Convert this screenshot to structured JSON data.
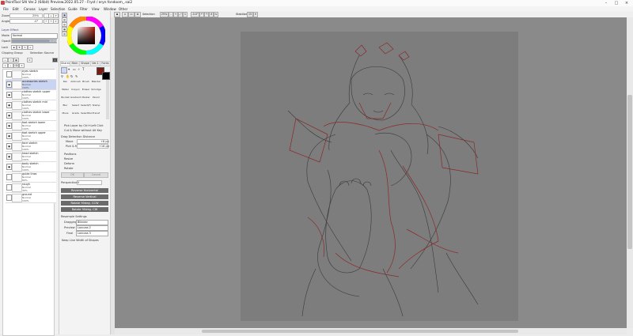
{
  "window": {
    "title": "PaintTool SAI Ver.2 (64bit) Preview.2022.05.27 - Fryst / eryn fondoom_.sai2"
  },
  "menu": [
    "File",
    "Edit",
    "Canvas",
    "Layer",
    "Selection",
    "Guide",
    "Filter",
    "View",
    "Window",
    "Other"
  ],
  "left": {
    "zoom_label": "Zoom",
    "zoom_value": "25%",
    "angle_label": "Angle",
    "angle_value": "-0°",
    "layer_effect": "Layer Effect",
    "mode_label": "Mode",
    "mode_value": "Normal",
    "opacity_label": "Opacity",
    "opacity_value": "100%",
    "lock_label": "Lock",
    "clipping": "Clipping Group",
    "sel_source": "Selection Source",
    "layers": [
      {
        "name": "eyes sketch",
        "mode": "Normal",
        "op": "100%"
      },
      {
        "name": "accessories sketch",
        "mode": "Normal",
        "op": "100%"
      },
      {
        "name": "clothes sketch upper",
        "mode": "Normal",
        "op": "100%"
      },
      {
        "name": "clothes sketch mid",
        "mode": "Normal",
        "op": "100%"
      },
      {
        "name": "clothes sketch lower",
        "mode": "Normal",
        "op": "100%"
      },
      {
        "name": "foot sketch lower",
        "mode": "Normal",
        "op": "100%"
      },
      {
        "name": "foot sketch upper",
        "mode": "Normal",
        "op": "100%"
      },
      {
        "name": "face sketch",
        "mode": "Normal",
        "op": "100%"
      },
      {
        "name": "head sketch",
        "mode": "Normal",
        "op": "100%"
      },
      {
        "name": "body sketch",
        "mode": "Normal",
        "op": "100%"
      },
      {
        "name": "guide lines",
        "mode": "Normal",
        "op": "60%"
      },
      {
        "name": "rough",
        "mode": "Normal",
        "op": "30%"
      },
      {
        "name": "ground",
        "mode": "Normal",
        "op": "100%"
      }
    ]
  },
  "tools": {
    "tabs": [
      "Shared",
      "Main",
      "Shape",
      "Ver.1",
      "Fonts"
    ],
    "grid": [
      "Pen",
      "Airbrush",
      "Brush",
      "Blender",
      "Water",
      "Crayon",
      "Eraser",
      "Smudge",
      "Bucket",
      "Gradient",
      "Marker",
      "Pencil",
      "Blur",
      "Select",
      "Select(F)",
      "Stamp",
      "Move",
      "Grade",
      "SelectPen",
      "Transf"
    ],
    "pick_layer": "Pick Layer by Ctrl+Left Click",
    "cut_move": "Cut & Move without Alt Key",
    "drag_dist": "Drag Detection Distance",
    "move_label": "Move",
    "move_value": "+8 px",
    "pick_label": "Pick & Move",
    "pick_value": "+16 px",
    "checks": [
      "Positions",
      "Resize",
      "Deform",
      "Rotate"
    ],
    "ok": "OK",
    "cancel": "Cancel",
    "perspective_label": "Perspective",
    "perspective_value": "0",
    "btns": [
      "Reverse Horizontal",
      "Reverse Vertical",
      "Rotate 90deg. CCW",
      "Rotate 90deg. CW"
    ],
    "resample_title": "Resample Settings",
    "dragging_label": "Dragging",
    "dragging_value": "Bilinear",
    "preview_label": "Preview",
    "preview_value": "Lanczos 2",
    "final_label": "Final",
    "final_value": "Lanczos 3",
    "keep_line": "Keep Line Width of Shapes"
  },
  "canvasbar": {
    "selection_label": "Selection",
    "zoom_value": "25%",
    "angle_value": "-0.0°",
    "stabilizer_label": "Stabilizer",
    "stabilizer_value": "15"
  },
  "colors": {
    "primary": "#7a1c12",
    "secondary": "#000000",
    "canvas_bg": "#8a8a8a",
    "paper": "#7d7d7d"
  }
}
